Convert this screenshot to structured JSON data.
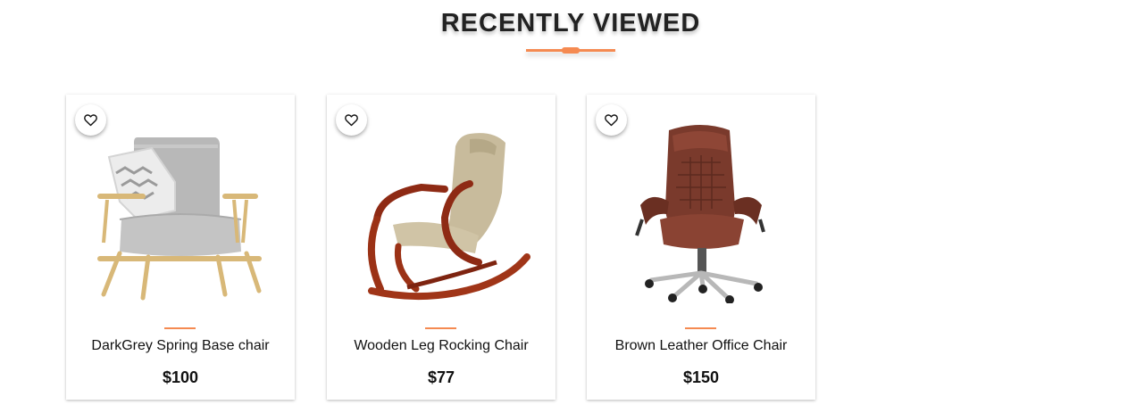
{
  "section": {
    "title": "RECENTLY VIEWED",
    "accent_color": "#f58a51"
  },
  "products": [
    {
      "name": "DarkGrey Spring Base chair",
      "price": "$100",
      "image": "grey-armchair-image",
      "wishlist_icon": "heart-outline-icon"
    },
    {
      "name": "Wooden Leg Rocking Chair",
      "price": "$77",
      "image": "wooden-rocking-chair-image",
      "wishlist_icon": "heart-outline-icon"
    },
    {
      "name": "Brown Leather Office Chair",
      "price": "$150",
      "image": "brown-office-chair-image",
      "wishlist_icon": "heart-outline-icon"
    }
  ]
}
